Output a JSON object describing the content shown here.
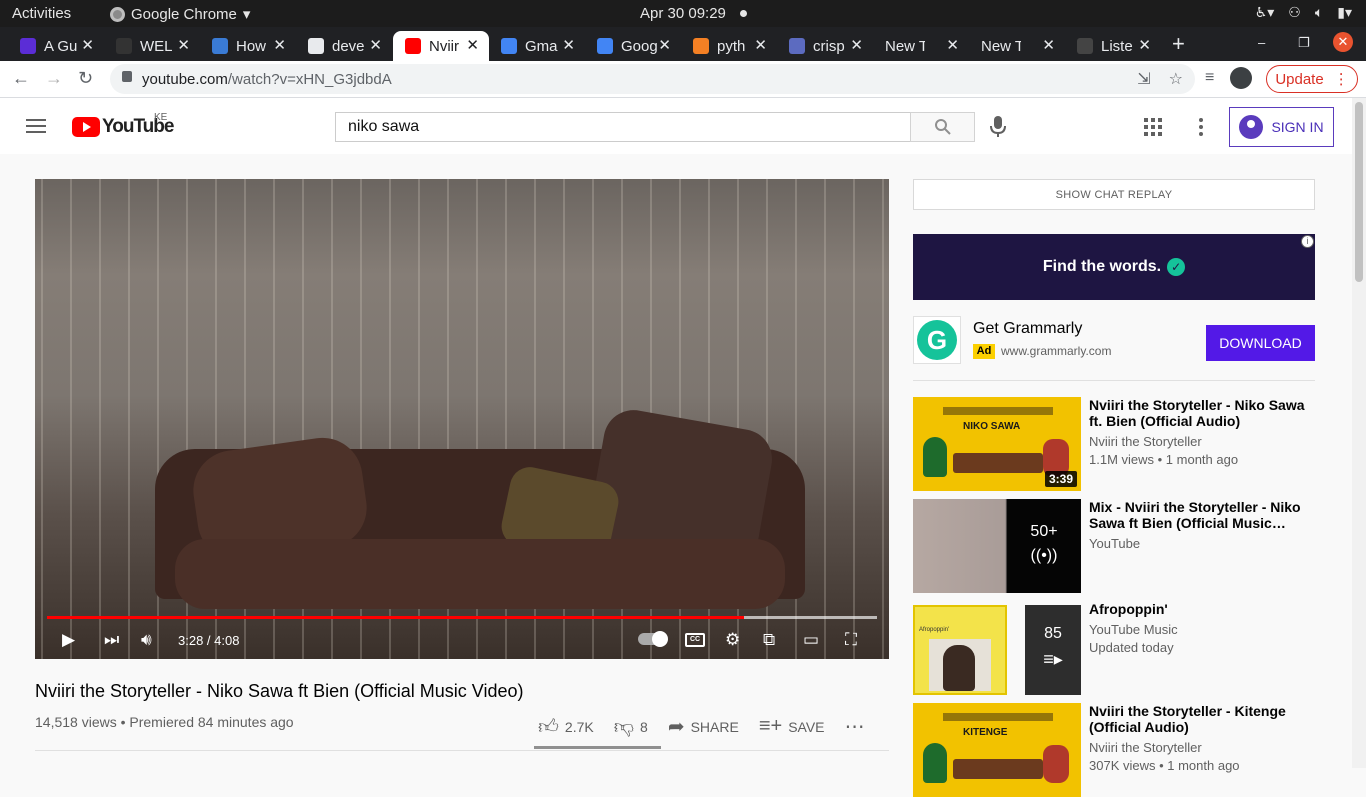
{
  "os": {
    "activities": "Activities",
    "app_menu": "Google Chrome",
    "clock": "Apr 30  09:29"
  },
  "tabs": [
    {
      "label": "A Gu",
      "favicon_color": "#5b2dd6",
      "icon": "code-icon"
    },
    {
      "label": "WEL",
      "favicon_color": "#333333",
      "icon": "github-icon"
    },
    {
      "label": "How",
      "favicon_color": "#3a7bd5",
      "icon": "s-icon"
    },
    {
      "label": "deve",
      "favicon_color": "#e8eaed",
      "icon": "dev-icon"
    },
    {
      "label": "Nviir",
      "favicon_color": "#ff0000",
      "icon": "youtube-icon",
      "active": true
    },
    {
      "label": "Gma",
      "favicon_color": "#4285f4",
      "icon": "google-icon"
    },
    {
      "label": "Goog",
      "favicon_color": "#4285f4",
      "icon": "google-icon"
    },
    {
      "label": "pyth",
      "favicon_color": "#f48024",
      "icon": "stackoverflow-icon"
    },
    {
      "label": "crisp",
      "favicon_color": "#5c6bc0",
      "icon": "doc-icon"
    },
    {
      "label": "New Tab",
      "favicon_color": "",
      "icon": ""
    },
    {
      "label": "New Tab",
      "favicon_color": "",
      "icon": ""
    },
    {
      "label": "Liste",
      "favicon_color": "#444444",
      "icon": "spotify-icon"
    }
  ],
  "omnibox": {
    "host": "youtube.com",
    "path": "/watch?v=xHN_G3jdbdA",
    "update_label": "Update"
  },
  "youtube": {
    "logo_text": "YouTube",
    "country_code": "KE",
    "search_value": "niko sawa",
    "signin_label": "SIGN IN"
  },
  "player": {
    "time": "3:28 / 4:08",
    "cc_label": "CC",
    "progress_played": 0.84,
    "progress_buffered": 1.0
  },
  "video": {
    "title": "Nviiri the Storyteller - Niko Sawa ft Bien (Official Music Video)",
    "meta": "14,518 views • Premiered 84 minutes ago",
    "likes": "2.7K",
    "dislikes": "8",
    "share_label": "SHARE",
    "save_label": "SAVE",
    "like_ratio": 0.997
  },
  "sidebar": {
    "chat_replay": "SHOW CHAT REPLAY",
    "ad": {
      "banner_text": "Find the words.",
      "name": "Get Grammarly",
      "badge": "Ad",
      "domain": "www.grammarly.com",
      "cta": "DOWNLOAD"
    },
    "recommendations": [
      {
        "title": "Nviiri the Storyteller - Niko Sawa ft. Bien (Official Audio)",
        "channel": "Nviiri the Storyteller",
        "stats": "1.1M views • 1 month ago",
        "duration": "3:39",
        "thumb_title": "NIKO SAWA"
      },
      {
        "title": "Mix - Nviiri the Storyteller - Niko Sawa ft Bien (Official Music…",
        "channel": "YouTube",
        "stats": "",
        "count": "50+"
      },
      {
        "title": "Afropoppin'",
        "channel": "YouTube Music",
        "stats": "Updated today",
        "count": "85",
        "thumb_label": "Afropoppin'"
      },
      {
        "title": "Nviiri the Storyteller - Kitenge (Official Audio)",
        "channel": "Nviiri the Storyteller",
        "stats": "307K views • 1 month ago",
        "thumb_title": "KITENGE"
      }
    ]
  }
}
